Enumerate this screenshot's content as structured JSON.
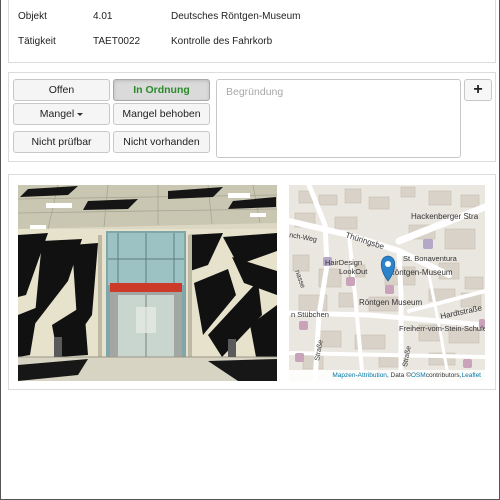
{
  "info": {
    "objekt": {
      "label": "Objekt",
      "number": "4.01",
      "name": "Deutsches Röntgen-Museum"
    },
    "taetigkeit": {
      "label": "Tätigkeit",
      "code": "TAET0022",
      "description": "Kontrolle des Fahrkorb"
    }
  },
  "actions": {
    "offen": "Offen",
    "in_ordnung": "In Ordnung",
    "mangel": "Mangel",
    "mangel_behoben": "Mangel behoben",
    "nicht_pruefbar": "Nicht prüfbar",
    "nicht_vorhanden": "Nicht vorhanden",
    "begruendung_placeholder": "Begründung",
    "add_label": "+"
  },
  "map": {
    "streets": [
      "Hackenberger Stra",
      "Thüringsbe",
      "nch-Weg",
      "St. Bonaventura",
      "Hardtstraße",
      "Freiherr-vom-Stein-Schule",
      "Straße",
      "Straße",
      "nasse"
    ],
    "pois": [
      "HairDesign",
      "LookOut",
      "Röntgen-Museum",
      "Röntgen Museum",
      "n Stübchen"
    ],
    "attribution": {
      "mapzen": "Mapzen",
      "sep": " - ",
      "attribution": "Attribution",
      "data": ", Data ©",
      "osm": "OSM",
      "contributors": " contributors, ",
      "leaflet": "Leaflet"
    }
  },
  "colors": {
    "active_text": "#2a8a2a",
    "marker": "#2b83cb",
    "link": "#0078a8"
  }
}
